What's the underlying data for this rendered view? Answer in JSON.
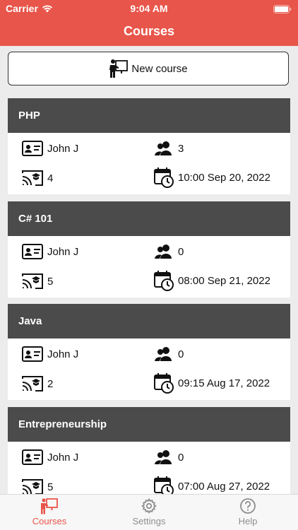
{
  "status_bar": {
    "carrier": "Carrier",
    "time": "9:04 AM"
  },
  "header": {
    "title": "Courses"
  },
  "new_course_button": {
    "label": "New course"
  },
  "courses": [
    {
      "name": "PHP",
      "teacher": "John J",
      "students": "3",
      "lessons": "4",
      "datetime": "10:00 Sep 20, 2022"
    },
    {
      "name": "C# 101",
      "teacher": "John J",
      "students": "0",
      "lessons": "5",
      "datetime": "08:00 Sep 21, 2022"
    },
    {
      "name": "Java",
      "teacher": "John J",
      "students": "0",
      "lessons": "2",
      "datetime": "09:15 Aug 17, 2022"
    },
    {
      "name": "Entrepreneurship",
      "teacher": "John J",
      "students": "0",
      "lessons": "5",
      "datetime": "07:00 Aug 27, 2022"
    }
  ],
  "tabs": [
    {
      "label": "Courses",
      "icon": "teacher-board-icon",
      "active": true
    },
    {
      "label": "Settings",
      "icon": "gear-icon",
      "active": false
    },
    {
      "label": "Help",
      "icon": "question-circle-icon",
      "active": false
    }
  ],
  "colors": {
    "accent": "#e8554a",
    "card_header": "#4b4b4b",
    "background": "#ececec"
  }
}
